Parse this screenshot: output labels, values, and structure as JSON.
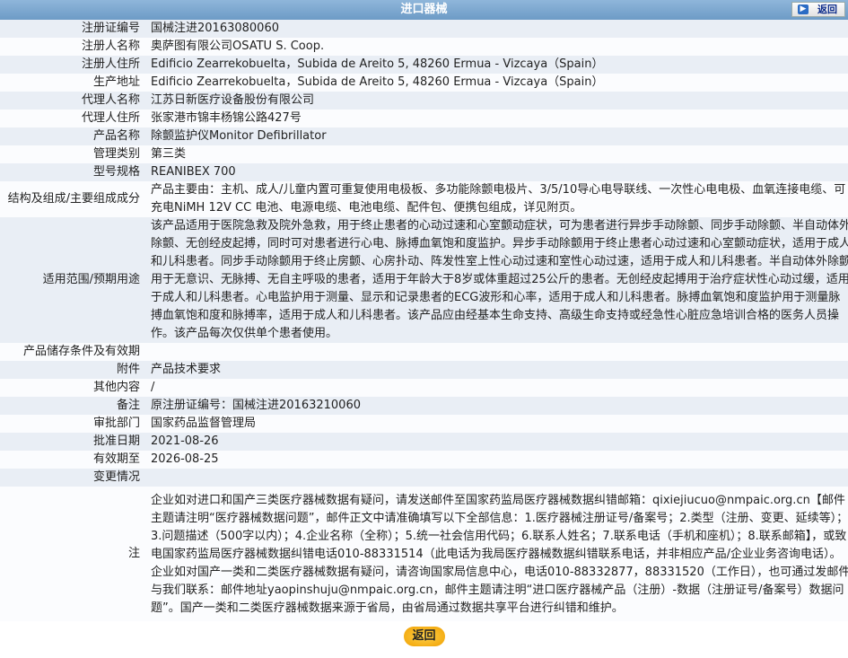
{
  "header": {
    "title": "进口器械",
    "back_label": "返回"
  },
  "rows": [
    {
      "label": "注册证编号",
      "value": "国械注进20163080060"
    },
    {
      "label": "注册人名称",
      "value": "奥萨图有限公司OSATU S. Coop."
    },
    {
      "label": "注册人住所",
      "value": "Edificio Zearrekobuelta，Subida de Areito 5, 48260 Ermua - Vizcaya（Spain）"
    },
    {
      "label": "生产地址",
      "value": "Edificio Zearrekobuelta，Subida de Areito 5, 48260 Ermua - Vizcaya（Spain）"
    },
    {
      "label": "代理人名称",
      "value": "江苏日新医疗设备股份有限公司"
    },
    {
      "label": "代理人住所",
      "value": "张家港市锦丰杨锦公路427号"
    },
    {
      "label": "产品名称",
      "value": "除颤监护仪Monitor Defibrillator"
    },
    {
      "label": "管理类别",
      "value": "第三类"
    },
    {
      "label": "型号规格",
      "value": "REANIBEX 700"
    },
    {
      "label": "结构及组成/主要组成成分",
      "value": "产品主要由：主机、成人/儿童内置可重复使用电极板、多功能除颤电极片、3/5/10导心电导联线、一次性心电电极、血氧连接电缆、可充电NiMH 12V CC 电池、电源电缆、电池电缆、配件包、便携包组成，详见附页。"
    },
    {
      "label": "适用范围/预期用途",
      "value": "该产品适用于医院急救及院外急救，用于终止患者的心动过速和心室颤动症状，可为患者进行异步手动除颤、同步手动除颤、半自动体外除颤、无创经皮起搏，同时可对患者进行心电、脉搏血氧饱和度监护。异步手动除颤用于终止患者心动过速和心室颤动症状，适用于成人和儿科患者。同步手动除颤用于终止房颤、心房扑动、阵发性室上性心动过速和室性心动过速，适用于成人和儿科患者。半自动体外除颤用于无意识、无脉搏、无自主呼吸的患者，适用于年龄大于8岁或体重超过25公斤的患者。无创经皮起搏用于治疗症状性心动过缓，适用于成人和儿科患者。心电监护用于测量、显示和记录患者的ECG波形和心率，适用于成人和儿科患者。脉搏血氧饱和度监护用于测量脉搏血氧饱和度和脉搏率，适用于成人和儿科患者。该产品应由经基本生命支持、高级生命支持或经急性心脏应急培训合格的医务人员操作。该产品每次仅供单个患者使用。"
    },
    {
      "label": "产品储存条件及有效期",
      "value": ""
    },
    {
      "label": "附件",
      "value": "产品技术要求"
    },
    {
      "label": "其他内容",
      "value": "/"
    },
    {
      "label": "备注",
      "value": "原注册证编号：国械注进20163210060"
    },
    {
      "label": "审批部门",
      "value": "国家药品监督管理局"
    },
    {
      "label": "批准日期",
      "value": "2021-08-26"
    },
    {
      "label": "有效期至",
      "value": "2026-08-25"
    },
    {
      "label": "变更情况",
      "value": ""
    },
    {
      "label": "注",
      "value": "企业如对进口和国产三类医疗器械数据有疑问，请发送邮件至国家药监局医疗器械数据纠错邮箱：qixiejiucuo@nmpaic.org.cn【邮件主题请注明“医疗器械数据问题”，邮件正文中请准确填写以下全部信息：1.医疗器械注册证号/备案号；2.类型（注册、变更、延续等）；3.问题描述（500字以内）；4.企业名称（全称）；5.统一社会信用代码；6.联系人姓名；7.联系电话（手机和座机）；8.联系邮箱】，或致电国家药监局医疗器械数据纠错电话010-88331514（此电话为我局医疗器械数据纠错联系电话，并非相应产品/企业业务咨询电话）。企业如对国产一类和二类医疗器械数据有疑问，请咨询国家局信息中心，电话010-88332877，88331520（工作日），也可通过发邮件与我们联系：邮件地址yaopinshuju@nmpaic.org.cn，邮件主题请注明“进口医疗器械产品（注册）-数据（注册证号/备案号）数据问题”。国产一类和二类医疗器械数据来源于省局，由省局通过数据共享平台进行纠错和维护。"
    }
  ],
  "footer": {
    "back_label": "返回"
  }
}
